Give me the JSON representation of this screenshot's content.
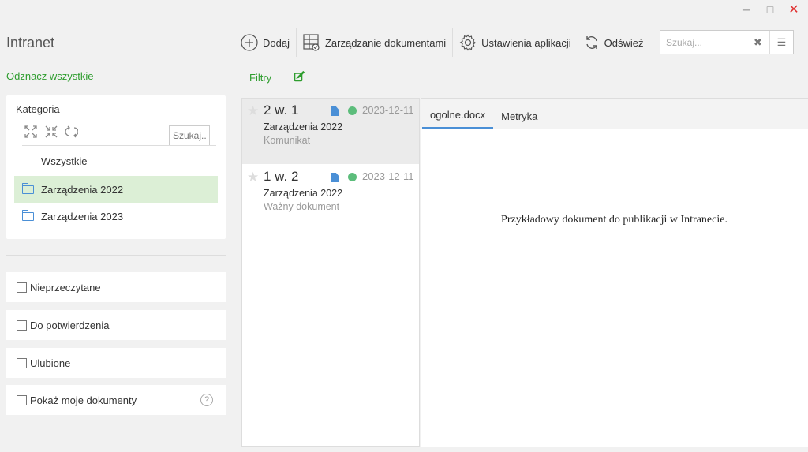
{
  "window": {
    "minimize": "─",
    "maximize": "□",
    "close": "✕"
  },
  "app_title": "Intranet",
  "select_all": "Odznacz wszystkie",
  "category_panel": {
    "title": "Kategoria",
    "search_placeholder": "Szukaj...",
    "items": [
      "Wszystkie",
      "Zarządzenia 2022",
      "Zarządzenia 2023"
    ]
  },
  "filters": [
    {
      "label": "Nieprzeczytane"
    },
    {
      "label": "Do potwierdzenia"
    },
    {
      "label": "Ulubione"
    },
    {
      "label": "Pokaż moje dokumenty",
      "help": "?"
    }
  ],
  "toolbar": {
    "add": "Dodaj",
    "manage": "Zarządzanie dokumentami",
    "settings": "Ustawienia aplikacji",
    "refresh": "Odśwież",
    "search_placeholder": "Szukaj..."
  },
  "filtry_label": "Filtry",
  "documents": [
    {
      "number": "2 w. 1",
      "date": "2023-12-11",
      "category": "Zarządzenia 2022",
      "type": "Komunikat",
      "status_color": "#5cbd7b"
    },
    {
      "number": "1 w. 2",
      "date": "2023-12-11",
      "category": "Zarządzenia 2022",
      "type": "Ważny dokument",
      "status_color": "#5cbd7b"
    }
  ],
  "preview": {
    "tabs": [
      "ogolne.docx",
      "Metryka"
    ],
    "content": "Przykładowy dokument do publikacji w Intranecie."
  },
  "colors": {
    "accent_green": "#2e9d2e",
    "accent_blue": "#4a8fd6",
    "selected_bg": "#dcefd6"
  }
}
